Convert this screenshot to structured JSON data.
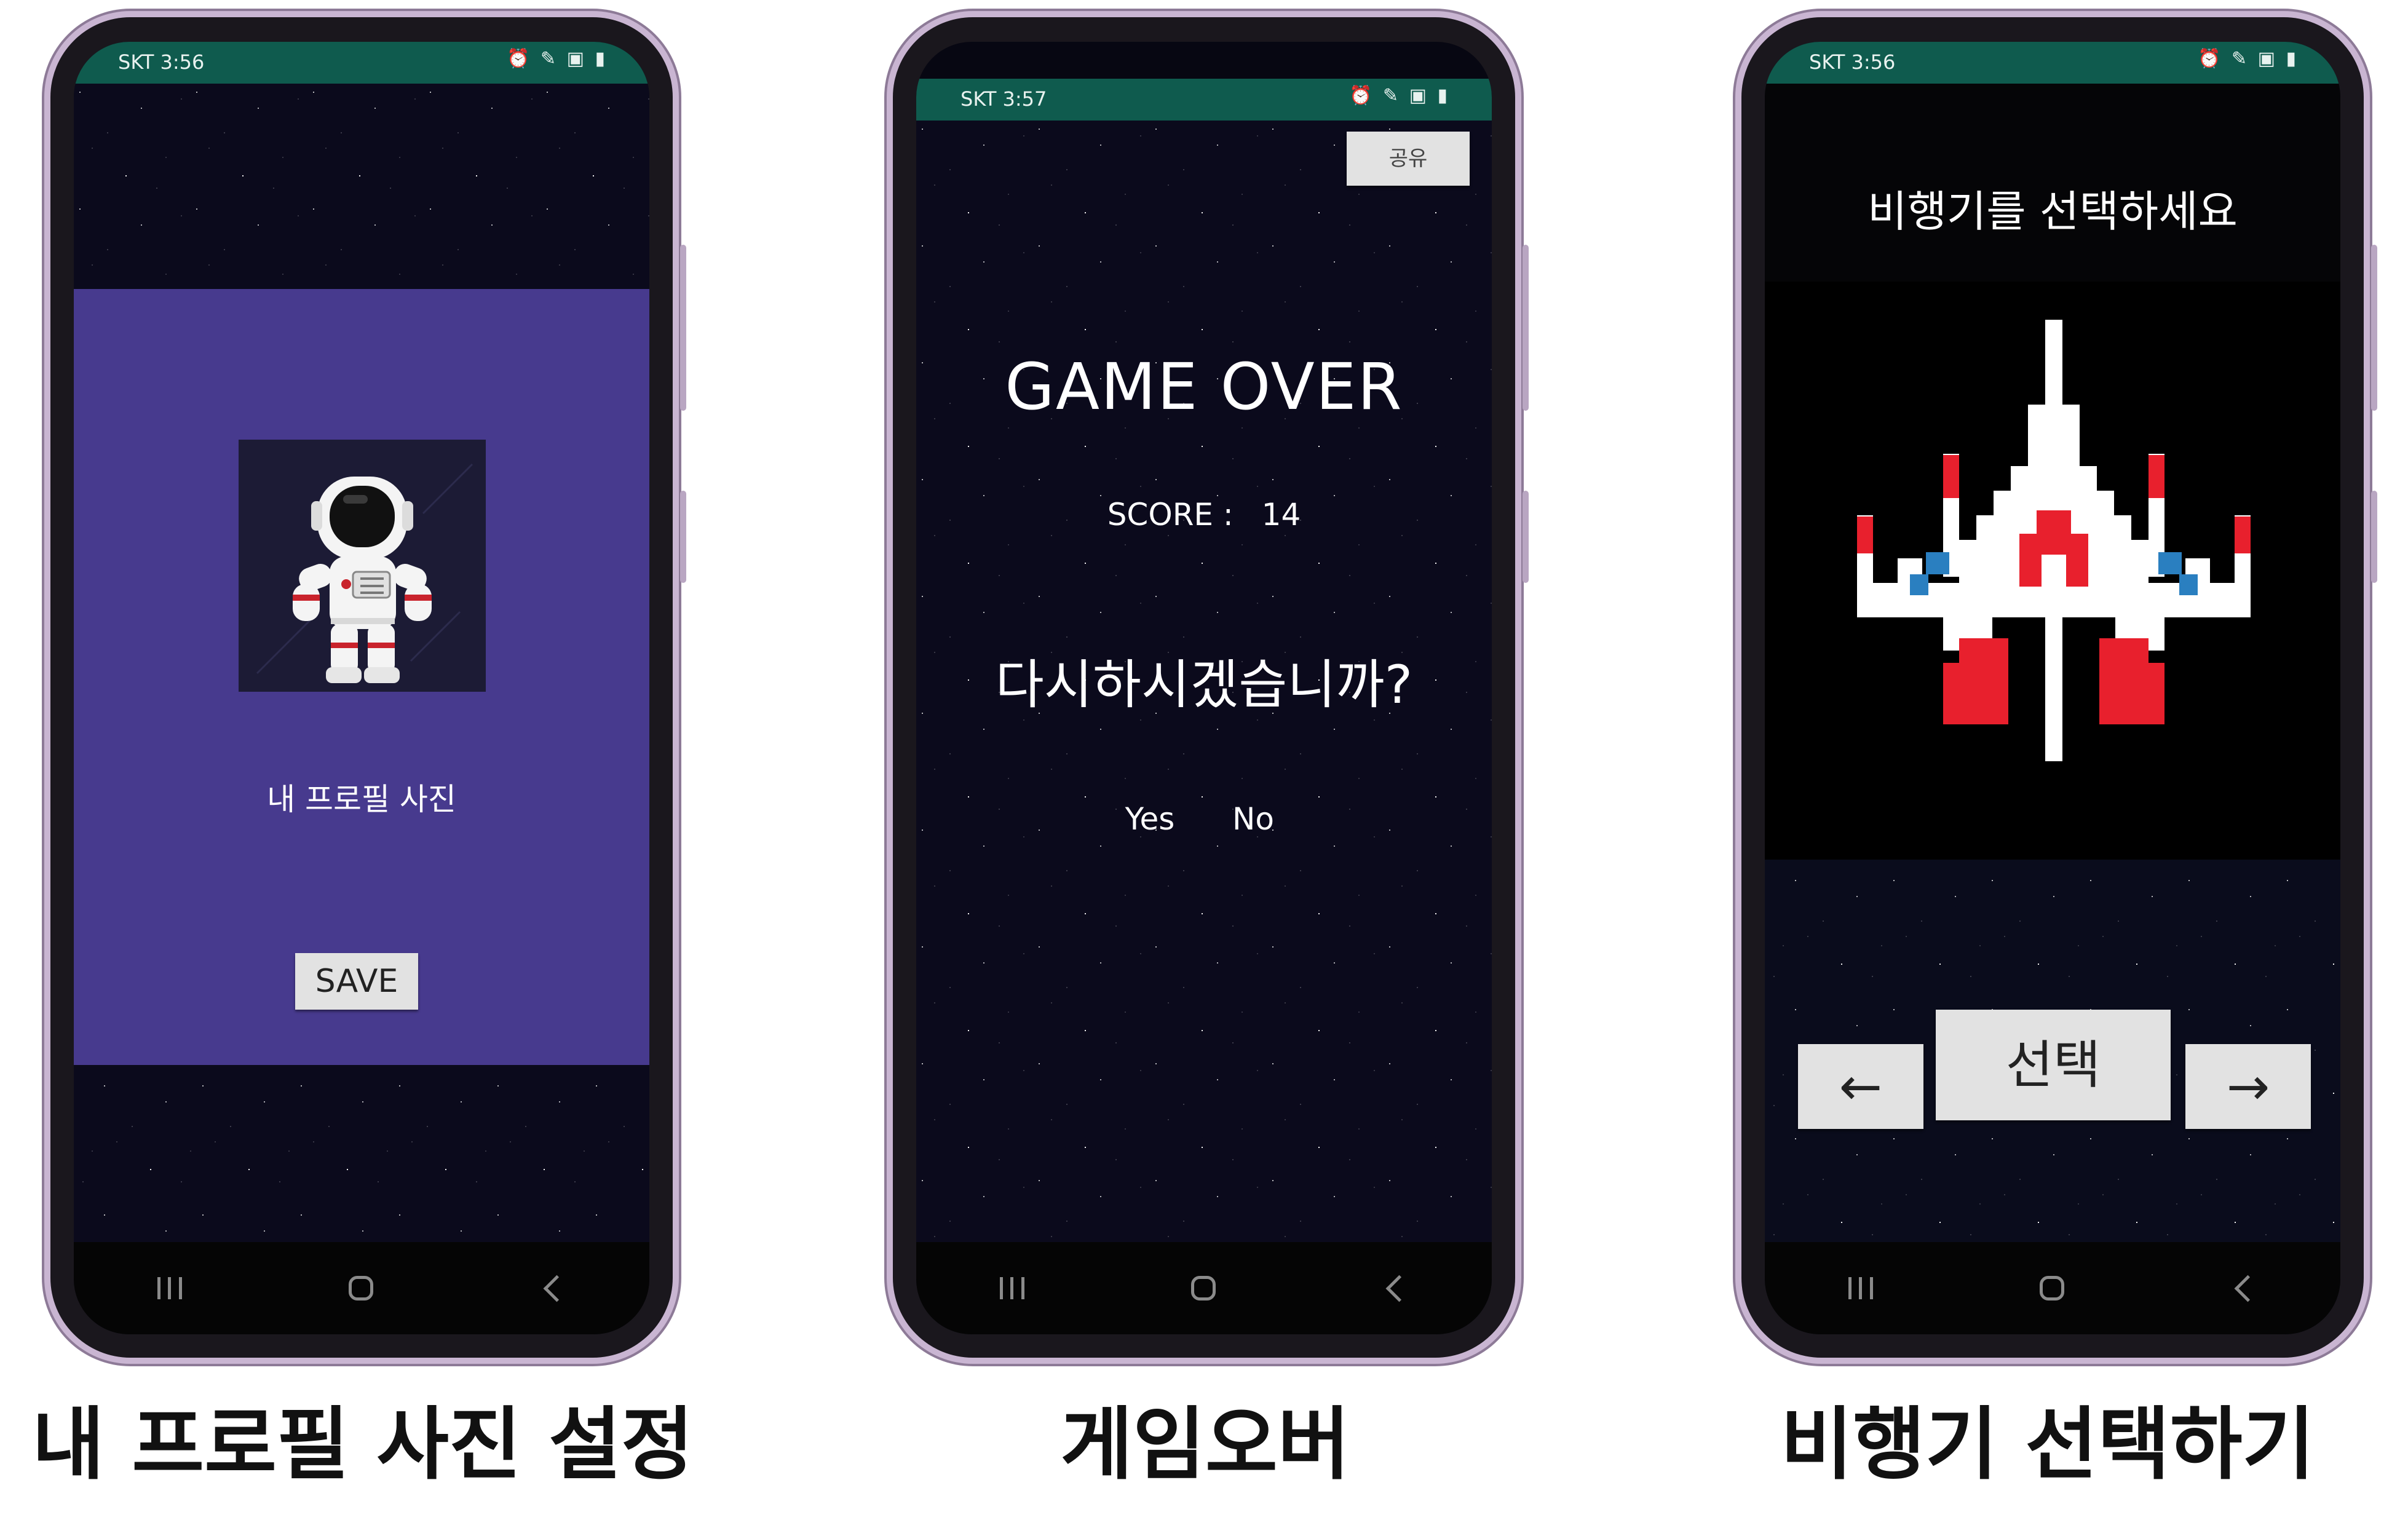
{
  "phones": [
    {
      "status": {
        "carrier": "SKT 3:56",
        "icons": "⏰ ✎ ▣ ▮"
      },
      "profile_label": "내 프로필 사진",
      "save_button": "SAVE",
      "caption": "내 프로필 사진 설정"
    },
    {
      "status": {
        "carrier": "SKT 3:57",
        "icons": "⏰ ✎ ▣ ▮"
      },
      "share_button": "공유",
      "title": "GAME OVER",
      "score_label": "SCORE :",
      "score_value": "14",
      "question": "다시하시겠습니까?",
      "yes": "Yes",
      "no": "No",
      "caption": "게임오버"
    },
    {
      "status": {
        "carrier": "SKT 3:56",
        "icons": "⏰ ✎ ▣ ▮"
      },
      "heading": "비행기를 선택하세요",
      "prev_button": "←",
      "select_button": "선택",
      "next_button": "→",
      "caption": "비행기 선택하기"
    }
  ],
  "colors": {
    "profile_panel": "#473a8e",
    "statusbar": "#0f5b4e",
    "ship_red": "#e8202d",
    "ship_blue": "#2a7fc0"
  }
}
